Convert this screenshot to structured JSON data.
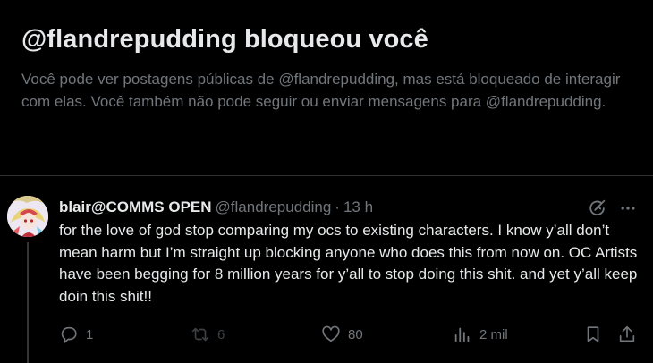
{
  "blocked_banner": {
    "title": "@flandrepudding bloqueou você",
    "description": "Você pode ver postagens públicas de @flandrepudding, mas está bloqueado de interagir com elas. Você também não pode seguir ou enviar mensagens para @flandrepudding."
  },
  "post": {
    "display_name": "blair@COMMS OPEN",
    "handle": "@flandrepudding",
    "separator": "·",
    "time": "13 h",
    "text": "for the love of god stop comparing my ocs to existing characters. I know y’all don’t mean harm but I’m straight up blocking anyone who does this from now on. OC Artists have been begging for 8 million years for y’all to stop doing this shit. and yet y’all keep doin this shit!!",
    "header_icons": [
      "grok-icon",
      "more-icon"
    ],
    "actions": {
      "reply_count": "1",
      "repost_count": "6",
      "like_count": "80",
      "views_count": "2 mil"
    }
  },
  "colors": {
    "background": "#000000",
    "primary_text": "#e7e9ea",
    "secondary_text": "#71767b",
    "divider": "#2f3336",
    "muted_icon": "#3e4144"
  }
}
